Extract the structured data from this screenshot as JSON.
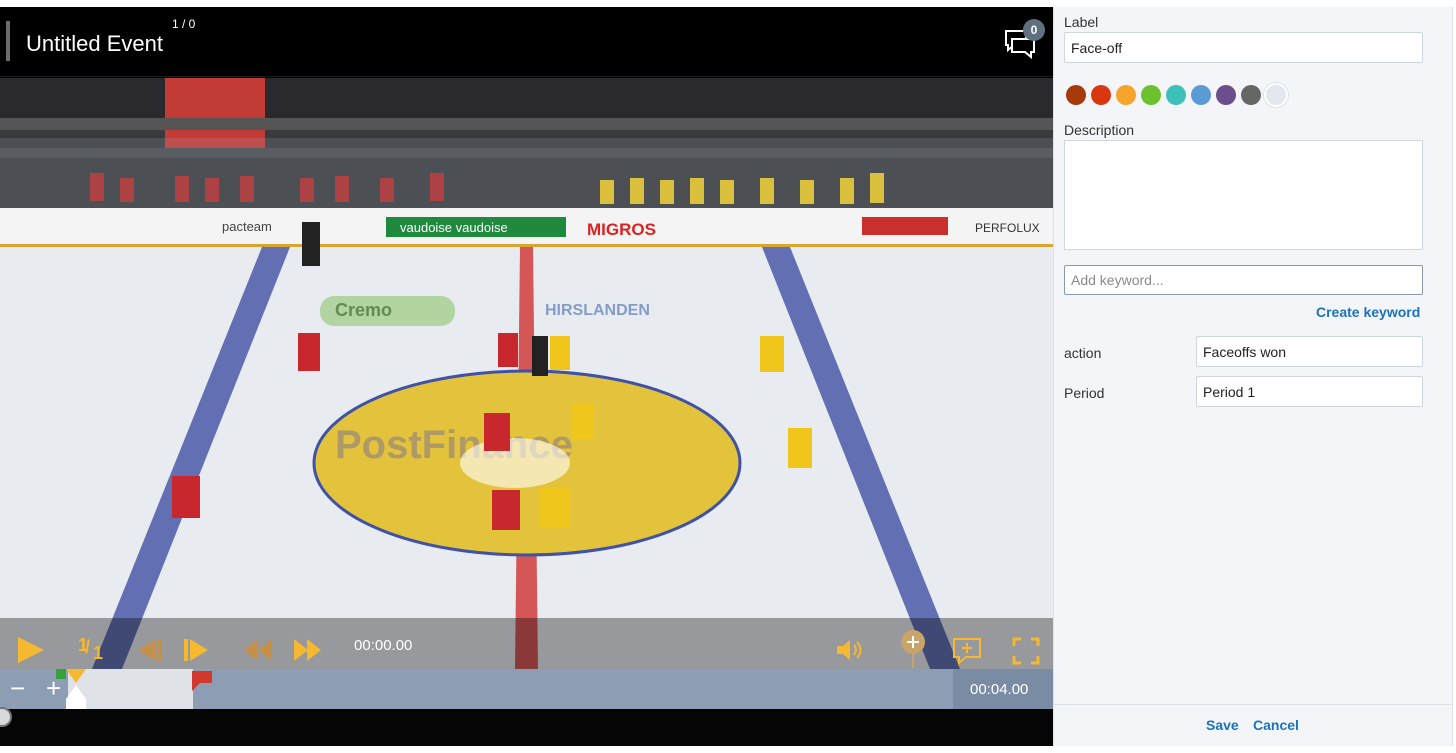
{
  "event": {
    "title": "Untitled Event",
    "counter": "1 / 0",
    "comment_count": "0"
  },
  "player": {
    "current_time": "00:00.00",
    "total_time": "00:04.00",
    "speed_numerator": "1",
    "speed_denominator": "1",
    "zoom_out_label": "−",
    "zoom_in_label": "+",
    "accent_color": "#f5b82e"
  },
  "form": {
    "label_heading": "Label",
    "label_value": "Face-off",
    "colors": [
      "#a63a0b",
      "#d9380f",
      "#f5a52b",
      "#6cc22c",
      "#3cc1b8",
      "#5b9bd5",
      "#6a4f8c",
      "#666666",
      "#e3e7ee"
    ],
    "selected_color_index": 8,
    "description_heading": "Description",
    "description_value": "",
    "keyword_placeholder": "Add keyword...",
    "create_keyword_label": "Create keyword",
    "fields": [
      {
        "name": "action",
        "value": "Faceoffs won"
      },
      {
        "name": "Period",
        "value": "Period 1"
      }
    ],
    "save_label": "Save",
    "cancel_label": "Cancel"
  }
}
